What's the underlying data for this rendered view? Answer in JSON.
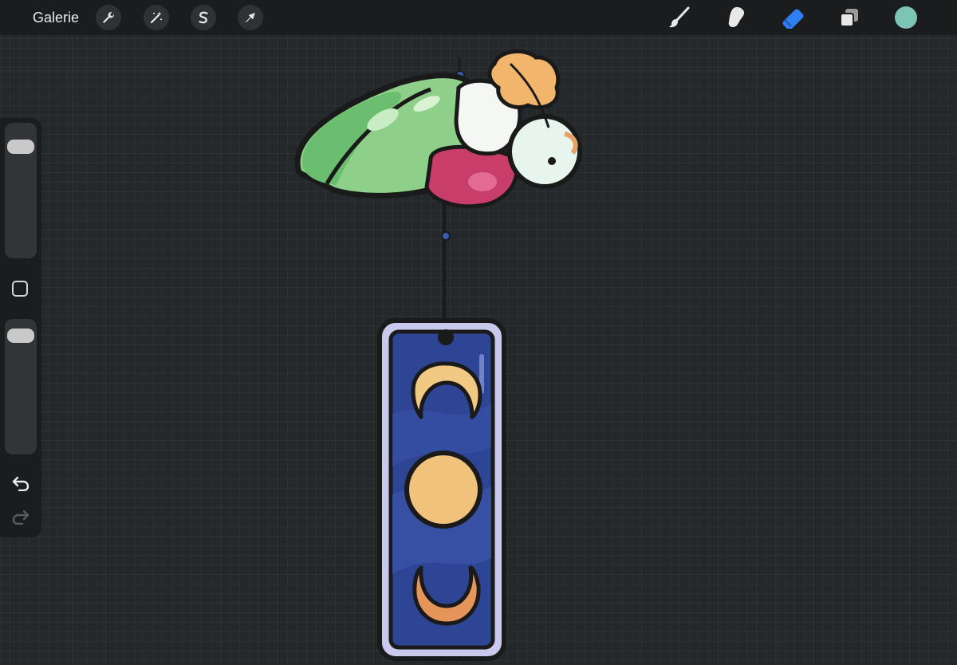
{
  "app": {
    "gallery_label": "Galerie"
  },
  "toolbar_left": {
    "tools": [
      {
        "name": "actions",
        "icon": "wrench-icon"
      },
      {
        "name": "adjustments",
        "icon": "magic-wand-icon"
      },
      {
        "name": "selection",
        "icon": "selection-s-icon"
      },
      {
        "name": "transform",
        "icon": "arrow-cursor-icon"
      }
    ]
  },
  "toolbar_right": {
    "tools": [
      {
        "name": "brush",
        "icon": "brush-icon",
        "active": false
      },
      {
        "name": "smudge",
        "icon": "smudge-icon",
        "active": false
      },
      {
        "name": "eraser",
        "icon": "eraser-icon",
        "active": true
      },
      {
        "name": "layers",
        "icon": "layers-icon",
        "active": false
      }
    ],
    "active_color": "#7cc4b4",
    "active_tool_color": "#2f7ff2"
  },
  "sidebar": {
    "brush_size_level": 0.88,
    "opacity_level": 0.94
  },
  "canvas": {
    "background": "#25282a",
    "artwork": "moth-wind-chime-with-moon-phases"
  }
}
